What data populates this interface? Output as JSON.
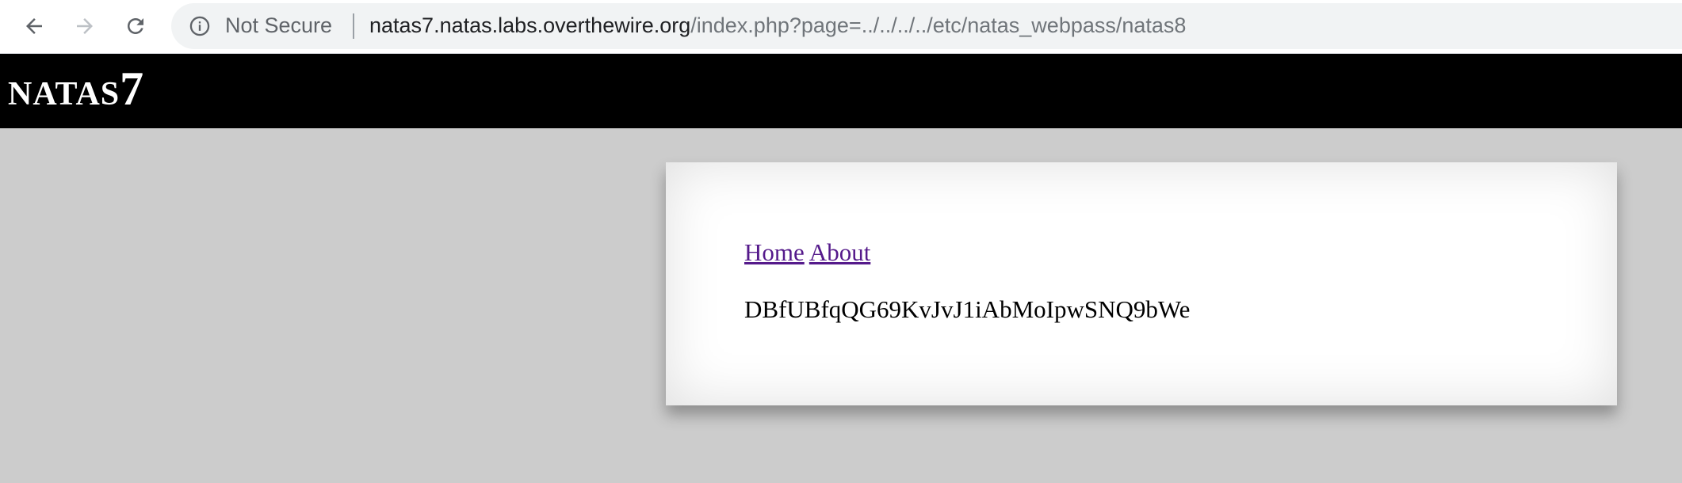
{
  "browser": {
    "security_label": "Not Secure",
    "url_host": "natas7.natas.labs.overthewire.org",
    "url_rest": "/index.php?page=../../../../etc/natas_webpass/natas8",
    "icons": [
      "back-arrow-icon",
      "forward-arrow-icon",
      "reload-icon",
      "info-icon"
    ]
  },
  "header": {
    "title": "natas7"
  },
  "content": {
    "nav": {
      "home_label": "Home",
      "about_label": "About"
    },
    "password": "DBfUBfqQG69KvJvJ1iAbMoIpwSNQ9bWe"
  },
  "colors": {
    "page_background": "#cccccc",
    "header_background": "#000000",
    "link_visited": "#551a8b",
    "omnibox_background": "#f1f3f4"
  }
}
